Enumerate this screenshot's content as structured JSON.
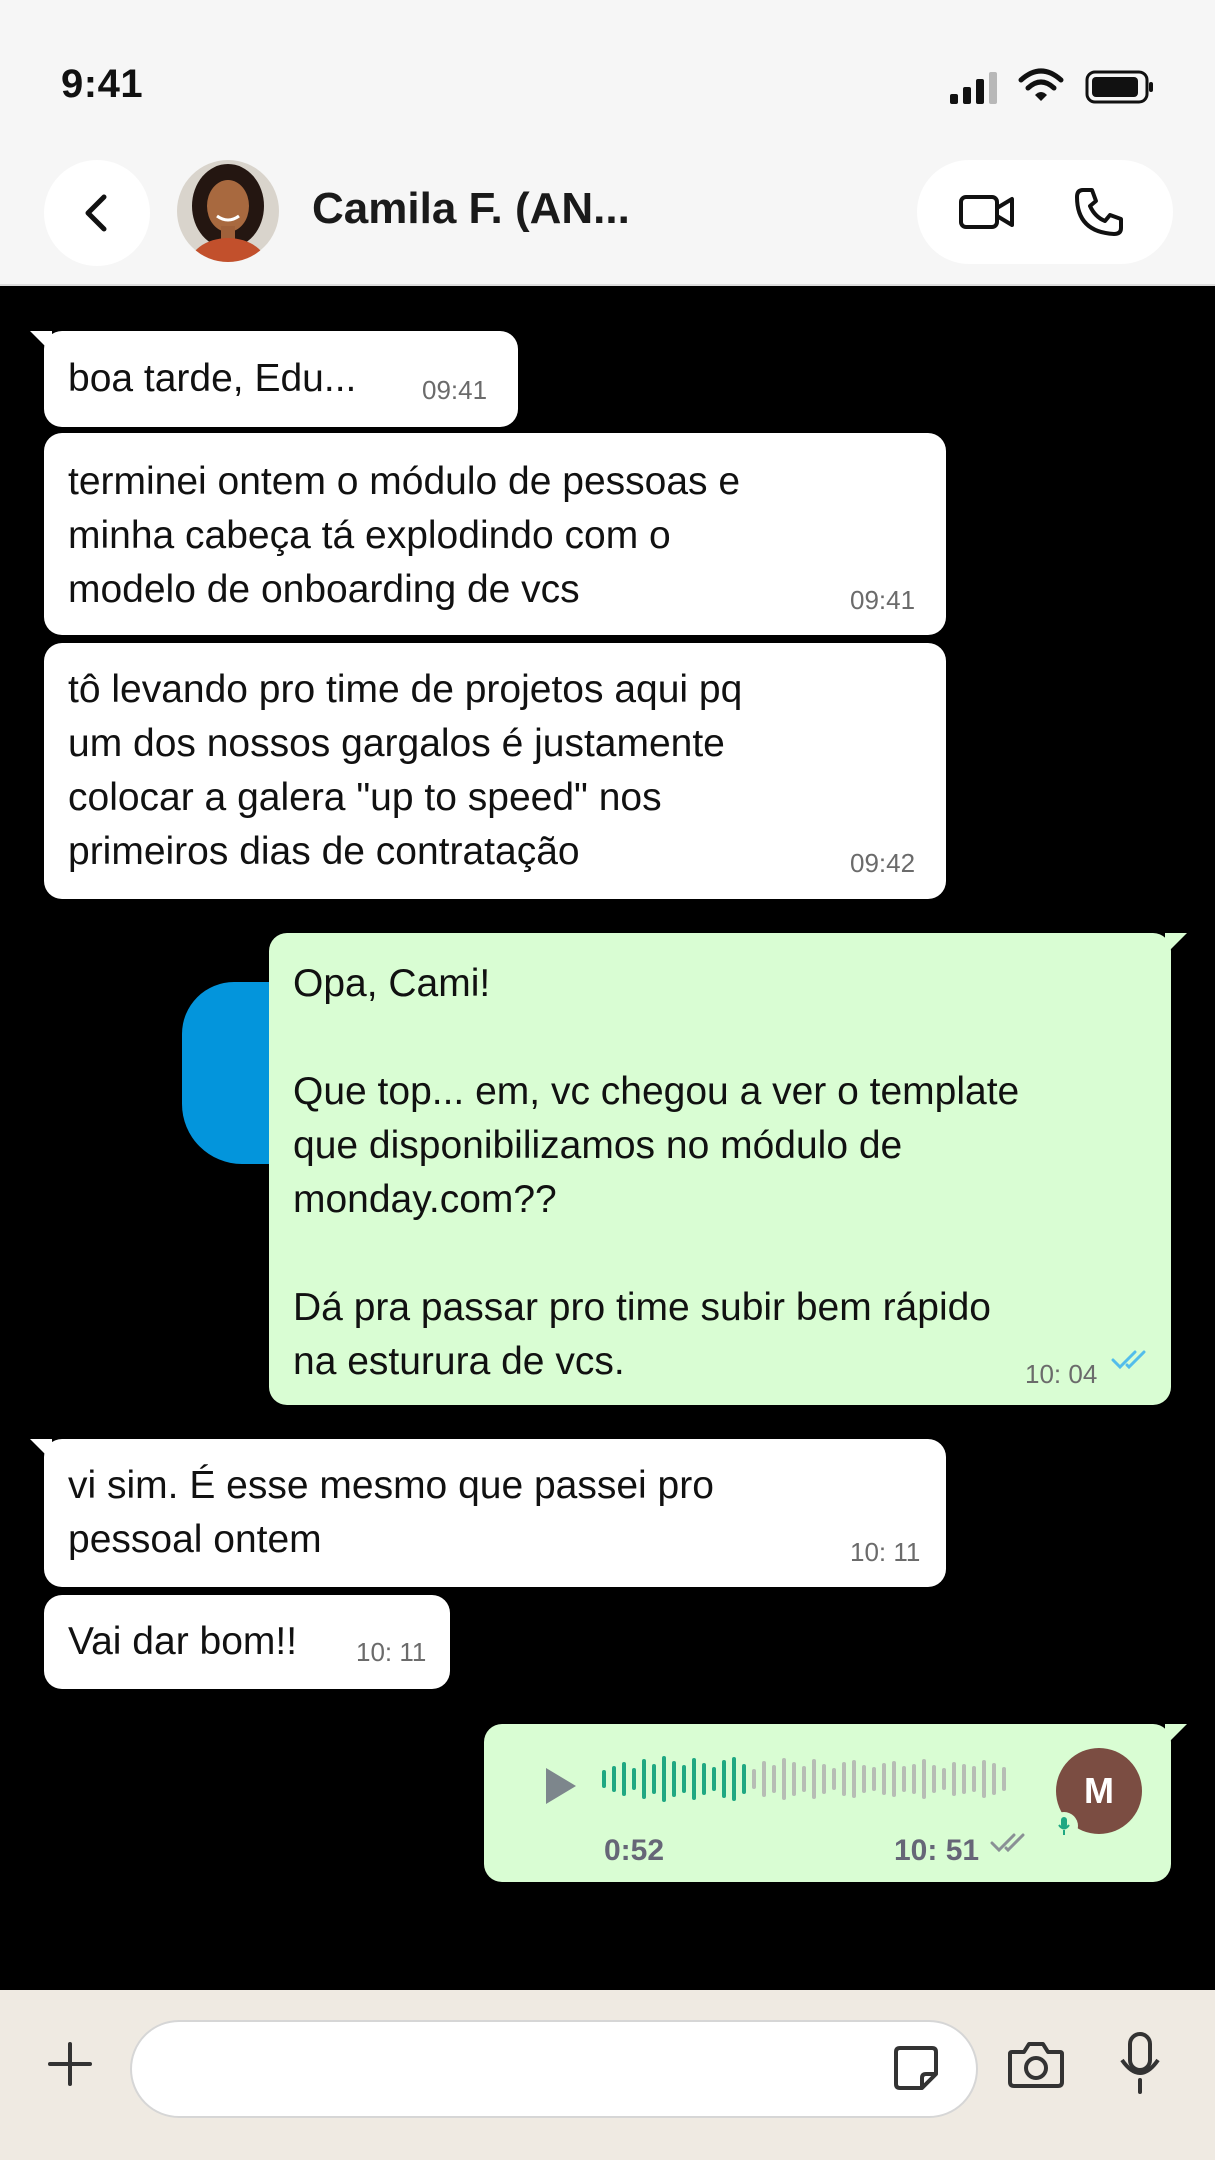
{
  "status_bar": {
    "time": "9:41"
  },
  "header": {
    "contact_name": "Camila F. (AN..."
  },
  "messages": [
    {
      "direction": "in",
      "text": "boa tarde, Edu...",
      "time": "09:41"
    },
    {
      "direction": "in",
      "text": "terminei ontem o módulo de pessoas e\nminha cabeça tá explodindo com o\nmodelo de onboarding de vcs",
      "time": "09:41"
    },
    {
      "direction": "in",
      "text": "tô levando pro time de projetos aqui pq\num dos nossos gargalos é justamente\ncolocar a galera \"up to speed\" nos\nprimeiros dias de contratação",
      "time": "09:42"
    },
    {
      "direction": "out",
      "text": "Opa, Cami!\n\nQue top... em, vc chegou a ver o template\nque disponibilizamos no módulo de\nmonday.com??\n\nDá pra passar pro time subir bem rápido\nna esturura de vcs.",
      "time": "10: 04",
      "status": "read"
    },
    {
      "direction": "in",
      "text": "vi sim. É esse mesmo que passei pro\npessoal ontem",
      "time": "10: 11"
    },
    {
      "direction": "in",
      "text": "Vai dar bom!!",
      "time": "10: 11"
    }
  ],
  "voice_message": {
    "duration": "0:52",
    "time": "10: 51",
    "avatar_initial": "M",
    "played_fraction": 0.36,
    "status": "delivered"
  },
  "input_bar": {
    "placeholder": "",
    "value": ""
  },
  "colors": {
    "incoming_bubble": "#ffffff",
    "outgoing_bubble": "#d9fdd3",
    "read_ticks": "#53bdeb",
    "waveform_played": "#1fa882",
    "waveform_unplayed": "#b7bdb5"
  },
  "icons": [
    "signal-icon",
    "wifi-icon",
    "battery-icon",
    "back-arrow-icon",
    "video-camera-icon",
    "phone-icon",
    "play-icon",
    "double-check-icon",
    "microphone-icon",
    "plus-icon",
    "sticker-icon",
    "camera-icon"
  ]
}
